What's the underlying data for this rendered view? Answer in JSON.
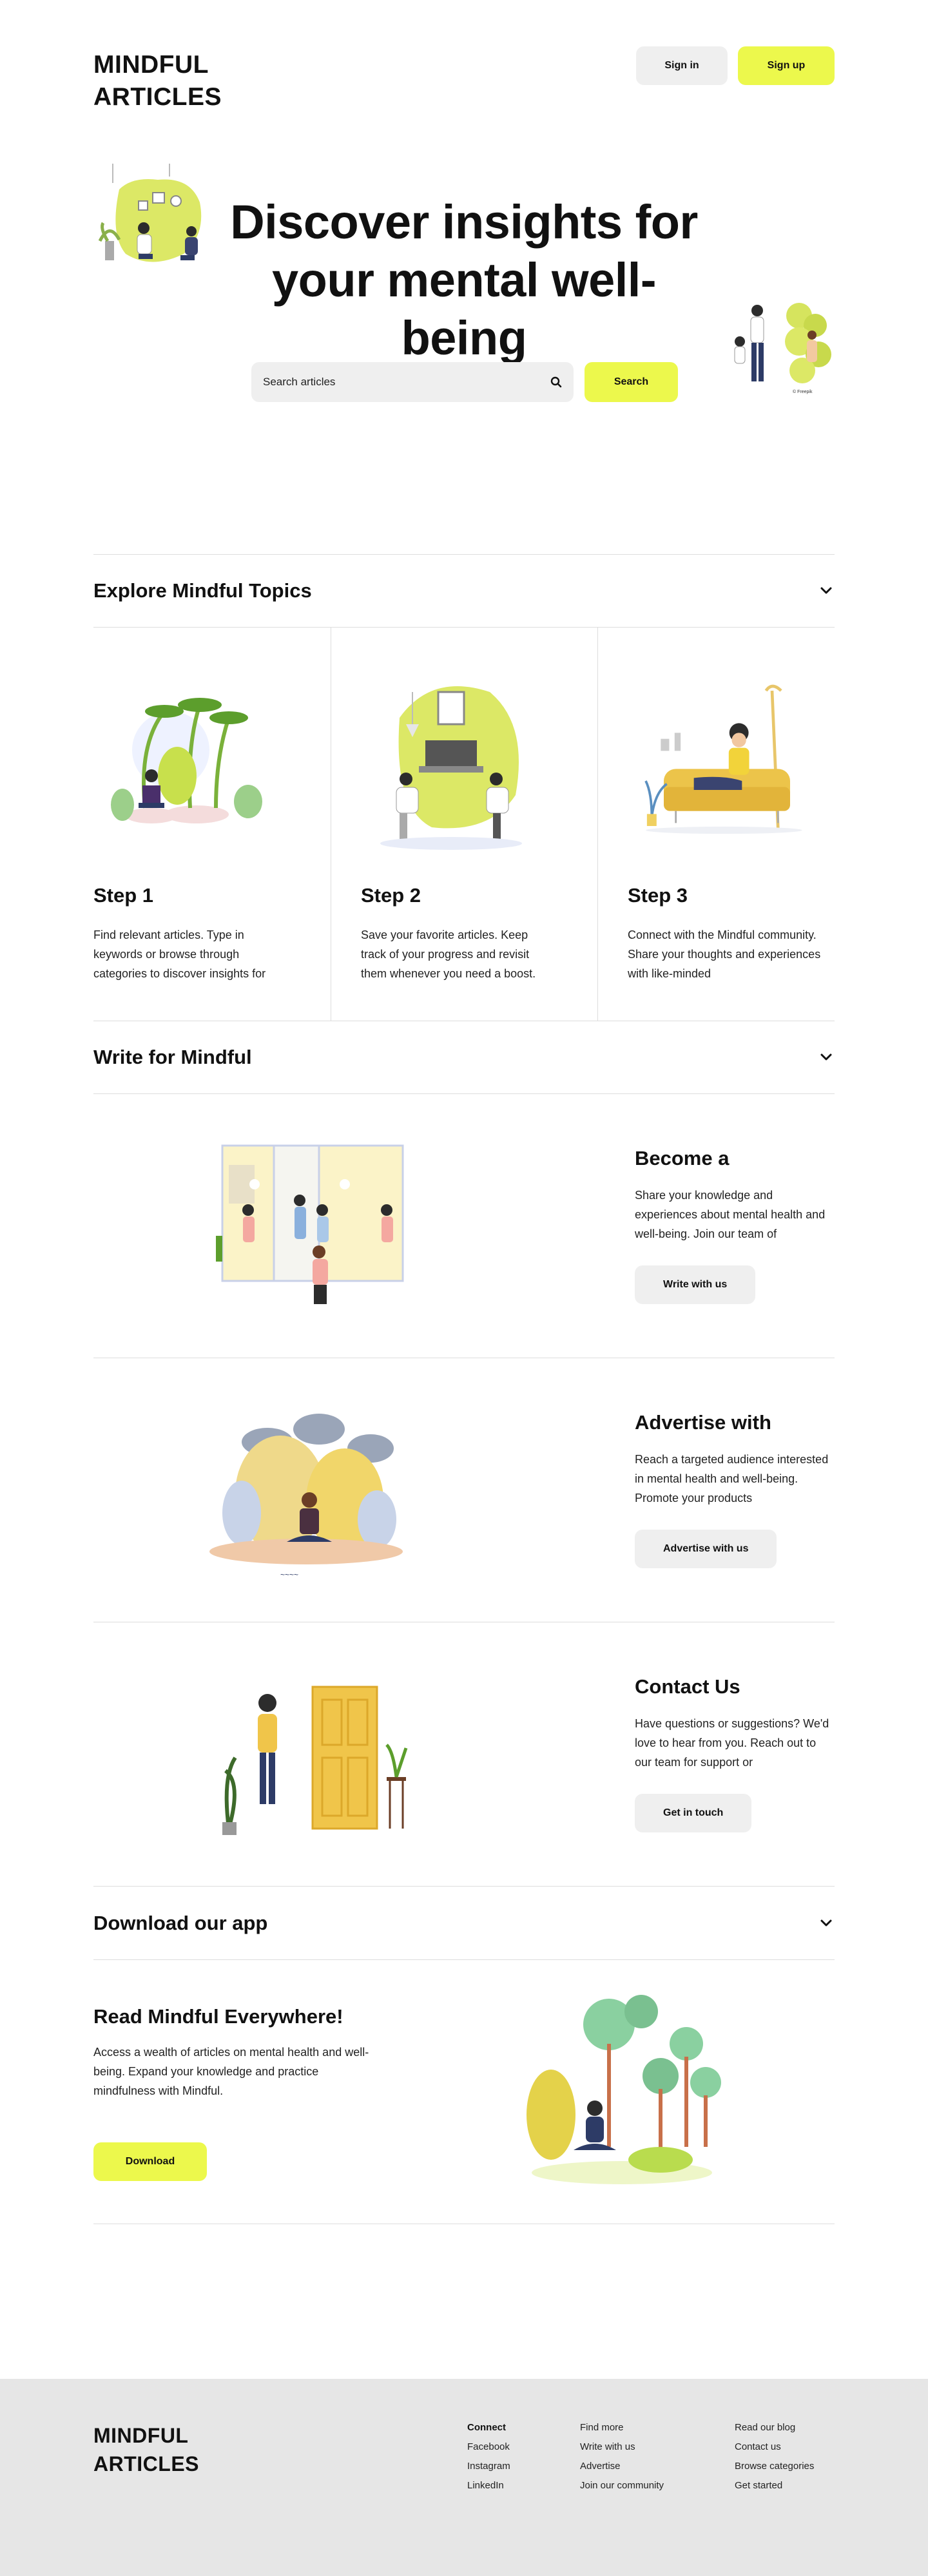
{
  "header": {
    "logo_line1": "MINDFUL",
    "logo_line2": "ARTICLES",
    "signin_label": "Sign in",
    "signup_label": "Sign up"
  },
  "hero": {
    "title_line1": "Discover insights for",
    "title_line2": "your mental well-being",
    "search_placeholder": "Search articles",
    "search_button": "Search"
  },
  "explore": {
    "heading": "Explore Mindful Topics",
    "steps": [
      {
        "title": "Step 1",
        "text": "Find relevant articles. Type in keywords or browse through categories to discover insights for"
      },
      {
        "title": "Step 2",
        "text": "Save your favorite articles. Keep track of your progress and revisit them whenever you need a boost."
      },
      {
        "title": "Step 3",
        "text": "Connect with the Mindful community. Share your thoughts and experiences with like-minded"
      }
    ]
  },
  "write": {
    "heading": "Write for Mindful",
    "rows": [
      {
        "title": "Become a",
        "text": "Share your knowledge and experiences about mental health and well-being. Join our team of",
        "button": "Write with us"
      },
      {
        "title": "Advertise with",
        "text": "Reach a targeted audience interested in mental health and well-being. Promote your products",
        "button": "Advertise with us"
      },
      {
        "title": "Contact Us",
        "text": "Have questions or suggestions? We'd love to hear from you. Reach out to our team for support or",
        "button": "Get in touch"
      }
    ]
  },
  "app": {
    "heading": "Download our app",
    "title": "Read Mindful Everywhere!",
    "text": "Access a wealth of articles on mental health and well-being. Expand your knowledge and practice mindfulness with Mindful.",
    "button": "Download"
  },
  "footer": {
    "logo_line1": "MINDFUL",
    "logo_line2": "ARTICLES",
    "col1": [
      "Connect",
      "Facebook",
      "Instagram",
      "LinkedIn"
    ],
    "col2": [
      "Find more",
      "Write with us",
      "Advertise",
      "Join our community"
    ],
    "col3": [
      "Read our blog",
      "Contact us",
      "Browse categories",
      "Get started"
    ]
  },
  "colors": {
    "accent": "#ecf84c",
    "button_grey": "#efefef",
    "footer_bg": "#e6e6e6"
  }
}
